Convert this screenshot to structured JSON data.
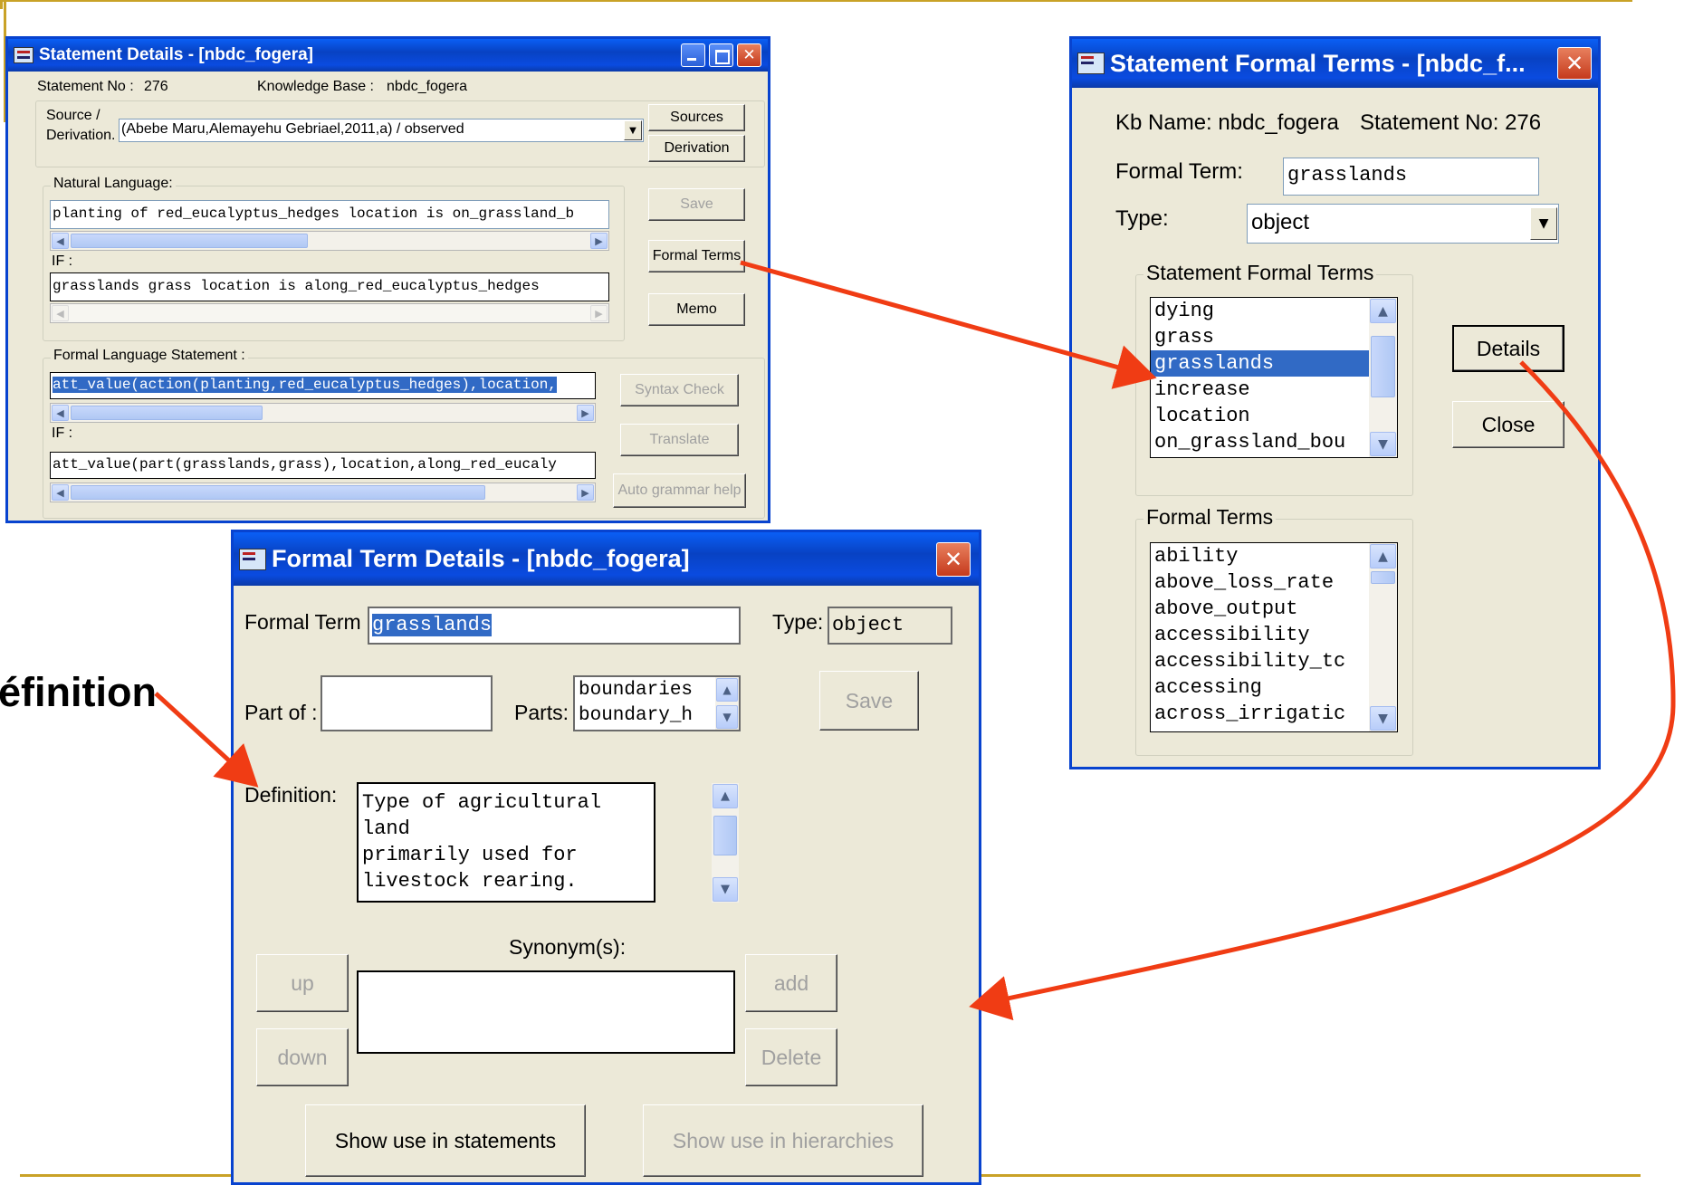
{
  "annotation_text": "éfinition",
  "statement_details": {
    "title": "Statement Details - [nbdc_fogera]",
    "statement_no_label": "Statement No :",
    "statement_no": "276",
    "kb_label": "Knowledge Base :",
    "kb_name": "nbdc_fogera",
    "source_label_1": "Source  /",
    "source_label_2": "Derivation.",
    "source_value": "(Abebe Maru,Alemayehu Gebriael,2011,a) / observed",
    "sources_btn": "Sources",
    "derivation_btn": "Derivation",
    "natural_language_label": "Natural Language:",
    "nl_text": "planting of red_eucalyptus_hedges location is on_grassland_b",
    "if_label": "IF :",
    "nl_if_text": "grasslands grass  location is along_red_eucalyptus_hedges",
    "save_btn": "Save",
    "formal_terms_btn": "Formal Terms",
    "memo_btn": "Memo",
    "formal_language_label": "Formal Language Statement :",
    "fl_text": "att_value(action(planting,red_eucalyptus_hedges),location,",
    "fl_if_text": "att_value(part(grasslands,grass),location,along_red_eucaly",
    "syntax_check_btn": "Syntax Check",
    "translate_btn": "Translate",
    "auto_grammar_btn": "Auto grammar help"
  },
  "statement_formal_terms": {
    "title": "Statement Formal Terms - [nbdc_f...",
    "kb_name_label": "Kb Name: nbdc_fogera",
    "statement_no_label": "Statement No: 276",
    "formal_term_label": "Formal Term:",
    "formal_term_value": "grasslands",
    "type_label": "Type:",
    "type_value": "object",
    "statement_terms_group": "Statement Formal Terms",
    "statement_terms": [
      "dying",
      "grass",
      "grasslands",
      "increase",
      "location",
      "on_grassland_bou"
    ],
    "selected_term": "grasslands",
    "details_btn": "Details",
    "close_btn": "Close",
    "formal_terms_group": "Formal Terms",
    "formal_terms": [
      "ability",
      "above_loss_rate",
      "above_output",
      "accessibility",
      "accessibility_tc",
      "accessing",
      "across_irrigatic"
    ]
  },
  "formal_term_details": {
    "title": "Formal Term Details - [nbdc_fogera]",
    "formal_term_label": "Formal Term :",
    "formal_term_value": "grasslands",
    "type_label": "Type:",
    "type_value": "object",
    "part_of_label": "Part of :",
    "part_of_value": "",
    "parts_label": "Parts:",
    "parts": [
      "boundaries",
      "boundary_h"
    ],
    "save_btn": "Save",
    "definition_label": "Definition:",
    "definition_lines": [
      "Type of agricultural land",
      "primarily used for",
      "livestock rearing."
    ],
    "synonyms_label": "Synonym(s):",
    "up_btn": "up",
    "down_btn": "down",
    "add_btn": "add",
    "delete_btn": "Delete",
    "show_statements_btn": "Show use in statements",
    "show_hierarchies_btn": "Show use in hierarchies"
  },
  "colors": {
    "window_face": "#ece9d8",
    "title_blue": "#0a4be0",
    "selection": "#316ac5",
    "arrow_red": "#f03c14",
    "slide_rule": "#c9a227"
  }
}
